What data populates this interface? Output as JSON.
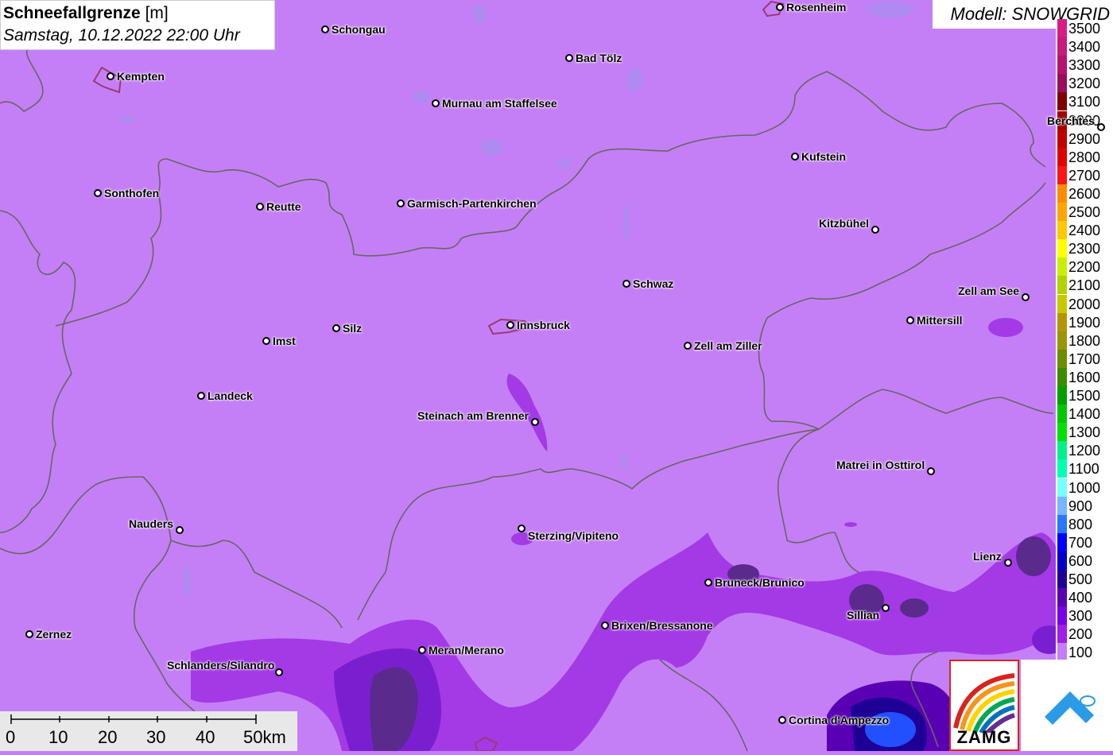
{
  "header": {
    "title_bold": "Schneefallgrenze",
    "title_unit": " [m]",
    "datetime": "Samstag, 10.12.2022 22:00 Uhr",
    "model": "Modell: SNOWGRID"
  },
  "legend": {
    "entries": [
      {
        "label": "3500",
        "color": "#d61e86"
      },
      {
        "label": "3400",
        "color": "#c81a7d"
      },
      {
        "label": "3300",
        "color": "#b41470"
      },
      {
        "label": "3200",
        "color": "#9a0f5c"
      },
      {
        "label": "3100",
        "color": "#800000"
      },
      {
        "label": "3000",
        "color": "#a00000"
      },
      {
        "label": "2900",
        "color": "#c00000"
      },
      {
        "label": "2800",
        "color": "#e00000"
      },
      {
        "label": "2700",
        "color": "#ff1414"
      },
      {
        "label": "2600",
        "color": "#ff8c00"
      },
      {
        "label": "2500",
        "color": "#ffa500"
      },
      {
        "label": "2400",
        "color": "#ffc800"
      },
      {
        "label": "2300",
        "color": "#ffff00"
      },
      {
        "label": "2200",
        "color": "#c8f000"
      },
      {
        "label": "2100",
        "color": "#b4d200"
      },
      {
        "label": "2000",
        "color": "#c8c800"
      },
      {
        "label": "1900",
        "color": "#b49600"
      },
      {
        "label": "1800",
        "color": "#9a9600"
      },
      {
        "label": "1700",
        "color": "#6e8c00"
      },
      {
        "label": "1600",
        "color": "#3c8c00"
      },
      {
        "label": "1500",
        "color": "#00a000"
      },
      {
        "label": "1400",
        "color": "#00c800"
      },
      {
        "label": "1300",
        "color": "#00e100"
      },
      {
        "label": "1200",
        "color": "#00f08c"
      },
      {
        "label": "1100",
        "color": "#00ffb4"
      },
      {
        "label": "1000",
        "color": "#78ffff"
      },
      {
        "label": "900",
        "color": "#78b4ff"
      },
      {
        "label": "800",
        "color": "#2878ff"
      },
      {
        "label": "700",
        "color": "#0000ff"
      },
      {
        "label": "600",
        "color": "#0000c8"
      },
      {
        "label": "500",
        "color": "#1e0096"
      },
      {
        "label": "400",
        "color": "#5a00b4"
      },
      {
        "label": "300",
        "color": "#7800e6"
      },
      {
        "label": "200",
        "color": "#a01ee6"
      },
      {
        "label": "100",
        "color": "#c57ff6"
      }
    ]
  },
  "towns": [
    {
      "name": "Rosenheim"
    },
    {
      "name": "Schongau"
    },
    {
      "name": "Bad Tölz"
    },
    {
      "name": "Kempten"
    },
    {
      "name": "Murnau am Staffelsee"
    },
    {
      "name": "Berchtes"
    },
    {
      "name": "Kufstein"
    },
    {
      "name": "Sonthofen"
    },
    {
      "name": "Reutte"
    },
    {
      "name": "Garmisch-Partenkirchen"
    },
    {
      "name": "Kitzbühel"
    },
    {
      "name": "Schwaz"
    },
    {
      "name": "Zell am See"
    },
    {
      "name": "Mittersill"
    },
    {
      "name": "Silz"
    },
    {
      "name": "Innsbruck"
    },
    {
      "name": "Imst"
    },
    {
      "name": "Zell am Ziller"
    },
    {
      "name": "Landeck"
    },
    {
      "name": "Steinach am Brenner"
    },
    {
      "name": "Matrei in Osttirol"
    },
    {
      "name": "Nauders"
    },
    {
      "name": "Sterzing/Vipiteno"
    },
    {
      "name": "Lienz"
    },
    {
      "name": "Bruneck/Brunico"
    },
    {
      "name": "Sillian"
    },
    {
      "name": "Brixen/Bressanone"
    },
    {
      "name": "Zernez"
    },
    {
      "name": "Meran/Merano"
    },
    {
      "name": "Schlanders/Silandro"
    },
    {
      "name": "Cortina d'Ampezzo"
    }
  ],
  "scalebar": {
    "ticks": [
      "0",
      "10",
      "20",
      "30",
      "40",
      "50km"
    ]
  },
  "logos": {
    "zamg": "ZAMG"
  }
}
